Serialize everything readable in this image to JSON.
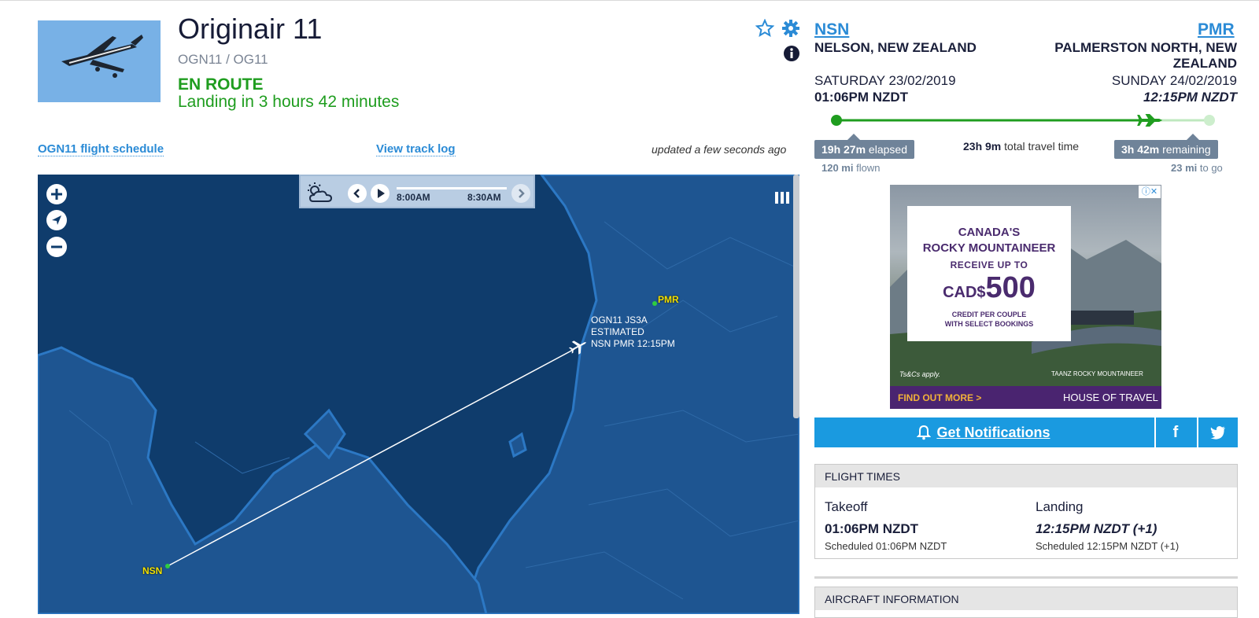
{
  "flight": {
    "title": "Originair 11",
    "ident": "OGN11 / OG11",
    "status": "EN ROUTE",
    "status_sub": "Landing in 3 hours 42 minutes"
  },
  "links": {
    "schedule": "OGN11 flight schedule",
    "track_log": "View track log",
    "updated": "updated a few seconds ago"
  },
  "map": {
    "timebar": {
      "time1": "8:00AM",
      "time2": "8:30AM"
    },
    "origin_label": "NSN",
    "dest_label": "PMR",
    "aircraft_label": [
      "OGN11 JS3A",
      "ESTIMATED",
      "NSN PMR 12:15PM"
    ]
  },
  "origin": {
    "code": "NSN",
    "city": "NELSON, NEW ZEALAND",
    "date": "SATURDAY 23/02/2019",
    "time": "01:06PM NZDT"
  },
  "destination": {
    "code": "PMR",
    "city_line1": "PALMERSTON NORTH, NEW",
    "city_line2": "ZEALAND",
    "date": "SUNDAY 24/02/2019",
    "time": "12:15PM NZDT"
  },
  "progress": {
    "fraction_complete": 0.84,
    "elapsed": "19h 27m",
    "elapsed_suffix": " elapsed",
    "total": "23h 9m",
    "total_suffix": " total travel time",
    "remaining": "3h 42m",
    "remaining_suffix": " remaining",
    "flown": "120 mi",
    "flown_suffix": " flown",
    "togo": "23 mi",
    "togo_suffix": " to go"
  },
  "ad": {
    "line1": "CANADA'S",
    "line2": "ROCKY MOUNTAINEER",
    "line3": "RECEIVE UP TO",
    "currency": "CAD$",
    "amount": "500",
    "line4": "CREDIT PER COUPLE",
    "line5": "WITH SELECT BOOKINGS",
    "fine": "Ts&Cs apply.",
    "partner": "TAANZ  ROCKY MOUNTAINEER",
    "cta": "FIND OUT MORE >",
    "brand": "HOUSE OF TRAVEL"
  },
  "notifications": {
    "label": "Get Notifications",
    "facebook": "f"
  },
  "flight_times": {
    "heading": "FLIGHT TIMES",
    "takeoff_label": "Takeoff",
    "takeoff_time": "01:06PM NZDT",
    "takeoff_sched": "Scheduled 01:06PM NZDT",
    "landing_label": "Landing",
    "landing_time": "12:15PM NZDT (+1)",
    "landing_sched": "Scheduled 12:15PM NZDT (+1)"
  },
  "aircraft_info": {
    "heading": "AIRCRAFT INFORMATION"
  },
  "colors": {
    "status_green": "#1f9d1f",
    "link_blue": "#2b8bd6",
    "map_sea": "#0f3c6c",
    "map_land": "#1e5591",
    "notif_blue": "#1a9ae0",
    "ad_purple": "#4a2470"
  }
}
